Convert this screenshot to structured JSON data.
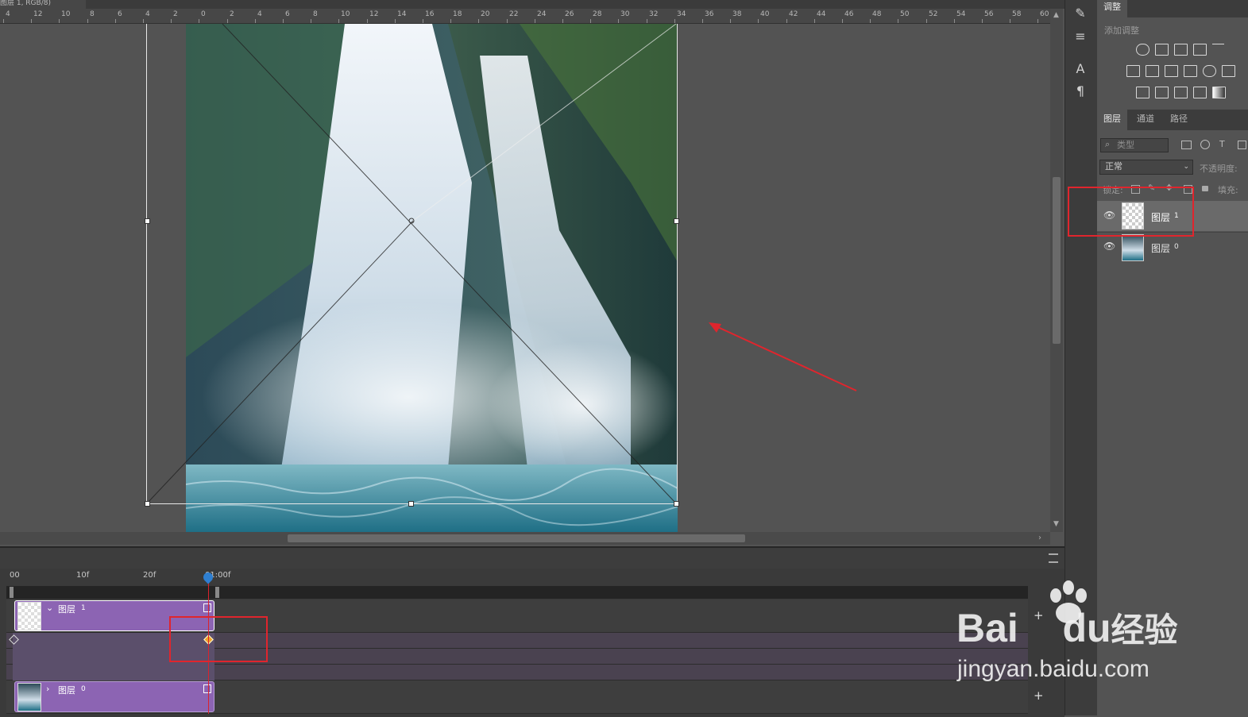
{
  "document": {
    "tab_title": "图层 1, RGB/8)"
  },
  "ruler": {
    "labels": [
      "4",
      "12",
      "10",
      "8",
      "6",
      "4",
      "2",
      "0",
      "2",
      "4",
      "6",
      "8",
      "10",
      "12",
      "14",
      "16",
      "18",
      "20",
      "22",
      "24",
      "26",
      "28",
      "30",
      "32",
      "34",
      "36",
      "38",
      "40",
      "42",
      "44",
      "46",
      "48",
      "50",
      "52",
      "54",
      "56",
      "58",
      "60"
    ]
  },
  "timeline": {
    "time_labels": [
      "00",
      "10f",
      "20f",
      "01:00f"
    ],
    "tracks": [
      {
        "name": "图层",
        "index": "1"
      },
      {
        "name": "图层",
        "index": "0"
      }
    ],
    "add_symbol": "+"
  },
  "adjustments": {
    "tab": "调整",
    "title": "添加调整"
  },
  "layers_panel": {
    "tabs": [
      "图层",
      "通道",
      "路径"
    ],
    "filter_placeholder": "类型",
    "blend_mode": "正常",
    "opacity_label": "不透明度:",
    "lock_label": "锁定:",
    "fill_label": "填充:",
    "layers": [
      {
        "name": "图层",
        "index": "1",
        "selected": true
      },
      {
        "name": "图层",
        "index": "0",
        "selected": false
      }
    ]
  },
  "watermark": {
    "brand": "Bai",
    "brand_tail": "du",
    "cn": "经验",
    "url": "jingyan.baidu.com"
  },
  "colors": {
    "annotation": "#e0252d",
    "clip": "#8c64b3",
    "playhead": "#d9232d"
  }
}
